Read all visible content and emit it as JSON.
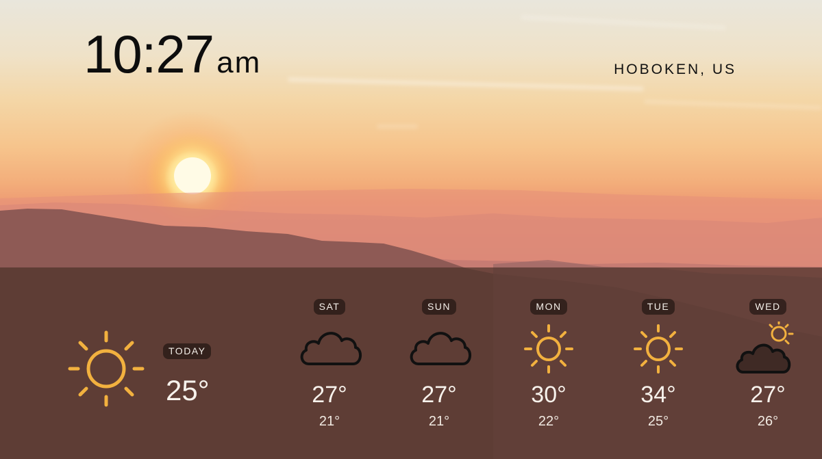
{
  "clock": {
    "time": "10:27",
    "ampm": "am"
  },
  "location": "HOBOKEN, US",
  "today": {
    "label": "TODAY",
    "temp": "25°",
    "icon": "sun-icon"
  },
  "forecast": [
    {
      "day": "SAT",
      "high": "27°",
      "low": "21°",
      "icon": "cloud-icon"
    },
    {
      "day": "SUN",
      "high": "27°",
      "low": "21°",
      "icon": "cloud-icon"
    },
    {
      "day": "MON",
      "high": "30°",
      "low": "22°",
      "icon": "sun-icon"
    },
    {
      "day": "TUE",
      "high": "34°",
      "low": "25°",
      "icon": "sun-icon"
    },
    {
      "day": "WED",
      "high": "27°",
      "low": "26°",
      "icon": "partly-cloudy-icon"
    }
  ],
  "colors": {
    "sun_icon": "#f2b13f",
    "cloud_outline": "#111111",
    "panel": "#4a3028"
  }
}
